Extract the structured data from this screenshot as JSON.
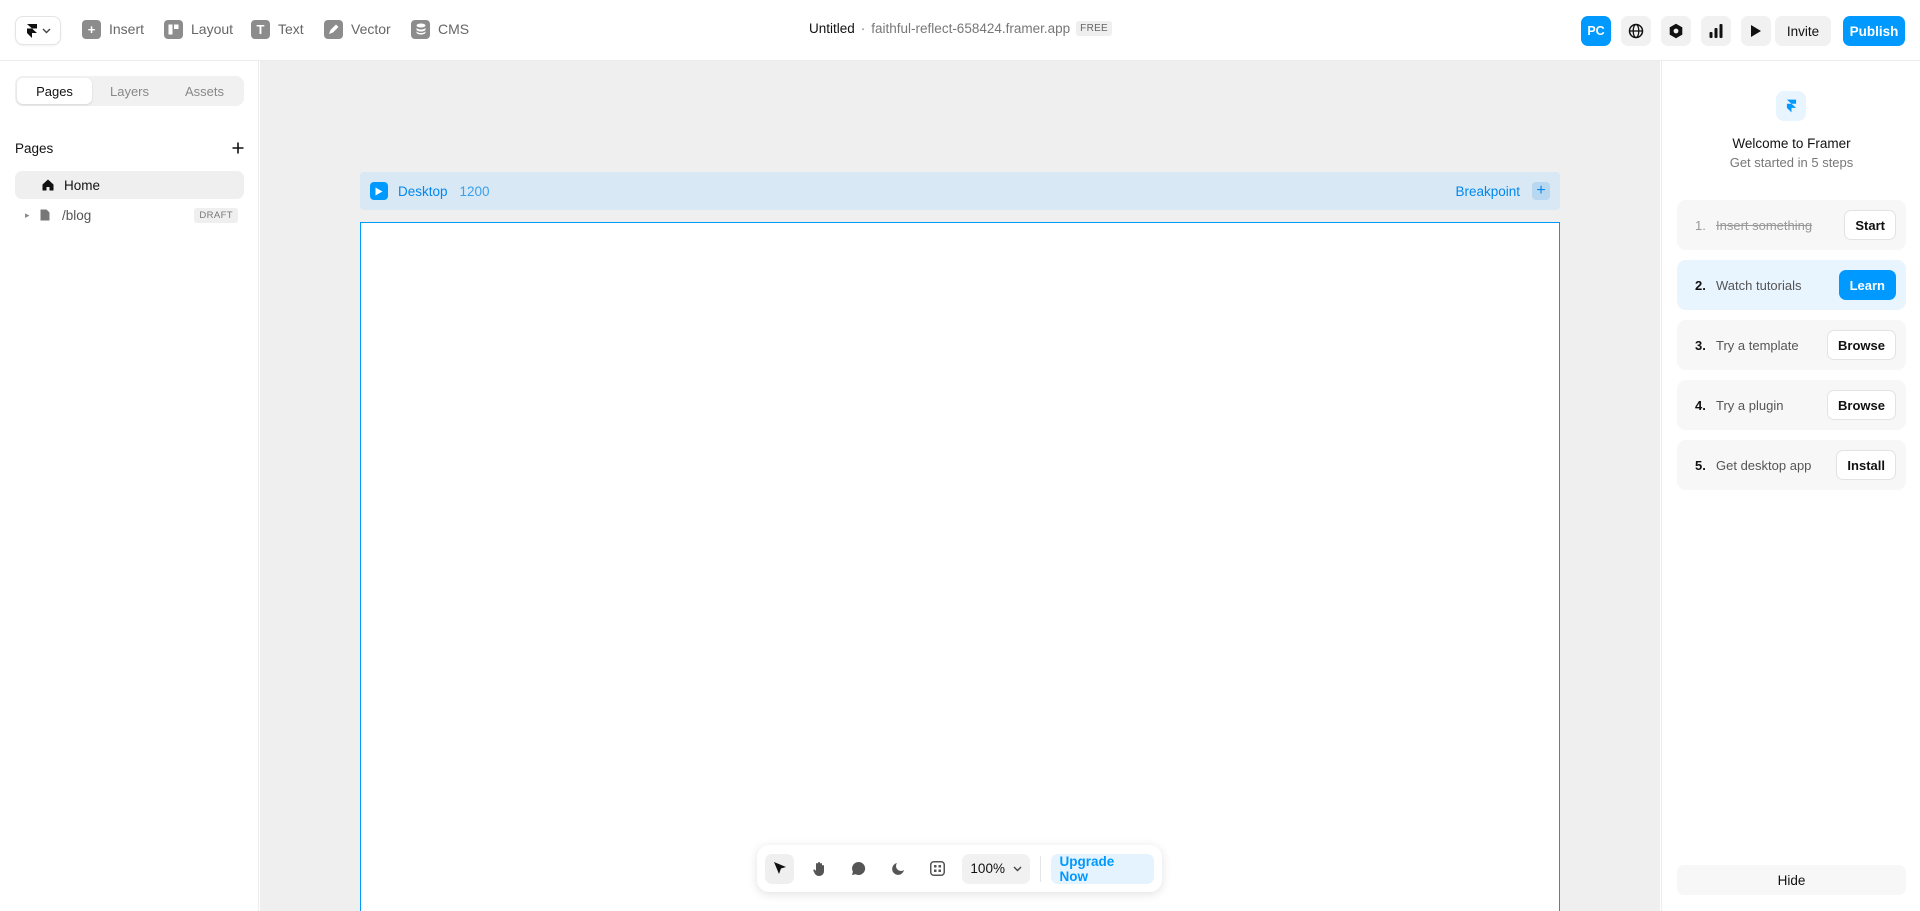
{
  "toolbar": {
    "tools": [
      {
        "label": "Insert",
        "icon": "plus-square-icon"
      },
      {
        "label": "Layout",
        "icon": "layout-icon"
      },
      {
        "label": "Text",
        "icon": "text-icon"
      },
      {
        "label": "Vector",
        "icon": "pen-icon"
      },
      {
        "label": "CMS",
        "icon": "database-icon"
      }
    ],
    "doc_title": "Untitled",
    "separator": "·",
    "domain": "faithful-reflect-658424.framer.app",
    "plan_badge": "FREE",
    "avatar_label": "PC",
    "invite_label": "Invite",
    "publish_label": "Publish"
  },
  "left_panel": {
    "tabs": [
      "Pages",
      "Layers",
      "Assets"
    ],
    "active_tab": "Pages",
    "section_title": "Pages",
    "pages": [
      {
        "name": "Home",
        "icon": "home-icon"
      },
      {
        "name": "/blog",
        "icon": "file-icon",
        "badge": "DRAFT"
      }
    ]
  },
  "canvas": {
    "breakpoint_name": "Desktop",
    "breakpoint_width": "1200",
    "breakpoint_add_label": "Breakpoint",
    "zoom": "100%",
    "upgrade_label": "Upgrade Now"
  },
  "right_panel": {
    "title": "Welcome to Framer",
    "subtitle": "Get started in 5 steps",
    "steps": [
      {
        "num": "1.",
        "label": "Insert something",
        "button": "Start",
        "done": true
      },
      {
        "num": "2.",
        "label": "Watch tutorials",
        "button": "Learn",
        "active": true
      },
      {
        "num": "3.",
        "label": "Try a template",
        "button": "Browse"
      },
      {
        "num": "4.",
        "label": "Try a plugin",
        "button": "Browse"
      },
      {
        "num": "5.",
        "label": "Get desktop app",
        "button": "Install"
      }
    ],
    "hide_label": "Hide"
  },
  "colors": {
    "accent": "#0099ff",
    "canvas_bg": "#efefef",
    "breakpoint_bar": "#d8e8f4"
  }
}
